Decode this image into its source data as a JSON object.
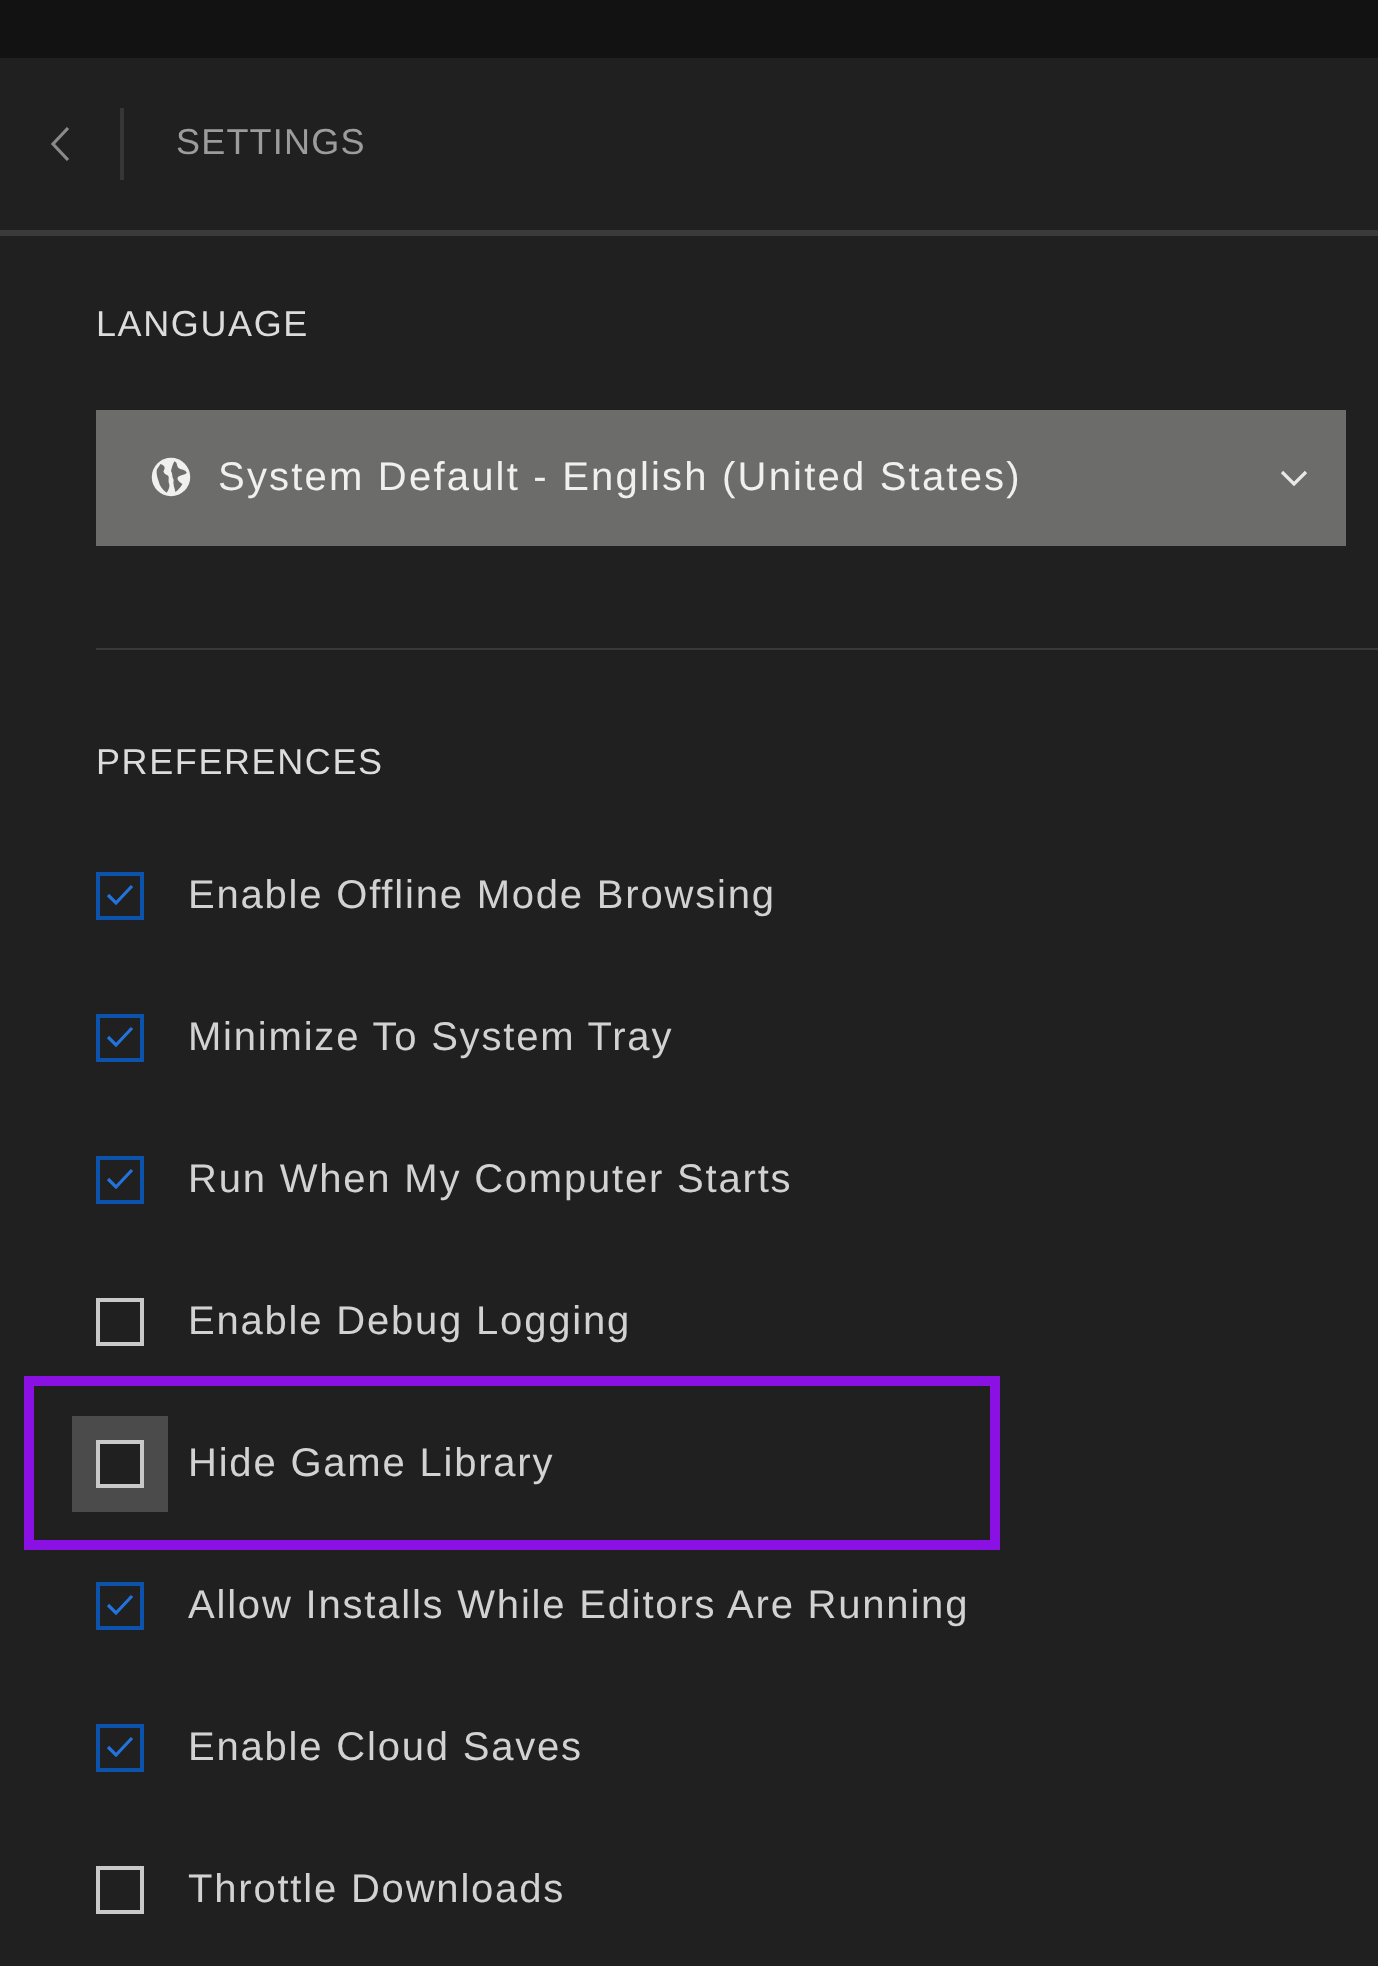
{
  "header": {
    "title": "SETTINGS"
  },
  "language": {
    "heading": "LANGUAGE",
    "dropdown": {
      "value": "System Default - English (United States)"
    }
  },
  "preferences": {
    "heading": "PREFERENCES",
    "items": [
      {
        "label": "Enable Offline Mode Browsing",
        "checked": true,
        "focused": false,
        "highlighted": false
      },
      {
        "label": "Minimize To System Tray",
        "checked": true,
        "focused": false,
        "highlighted": false
      },
      {
        "label": "Run When My Computer Starts",
        "checked": true,
        "focused": false,
        "highlighted": false
      },
      {
        "label": "Enable Debug Logging",
        "checked": false,
        "focused": false,
        "highlighted": false
      },
      {
        "label": "Hide Game Library",
        "checked": false,
        "focused": true,
        "highlighted": true
      },
      {
        "label": "Allow Installs While Editors Are Running",
        "checked": true,
        "focused": false,
        "highlighted": false
      },
      {
        "label": "Enable Cloud Saves",
        "checked": true,
        "focused": false,
        "highlighted": false
      },
      {
        "label": "Throttle Downloads",
        "checked": false,
        "focused": false,
        "highlighted": false
      }
    ]
  }
}
